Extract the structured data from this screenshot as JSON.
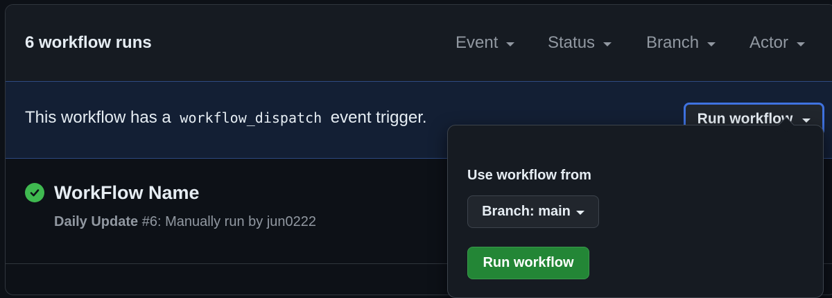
{
  "header": {
    "title": "6 workflow runs",
    "filters": [
      "Event",
      "Status",
      "Branch",
      "Actor"
    ]
  },
  "banner": {
    "text_before": "This workflow has a",
    "code": "workflow_dispatch",
    "text_after": "event trigger.",
    "run_button_label": "Run workflow"
  },
  "run": {
    "title": "WorkFlow Name",
    "workflow_name": "Daily Update",
    "run_number": "#6",
    "description": ": Manually run by jun0222",
    "status_icon": "check-circle-icon"
  },
  "dropdown": {
    "label": "Use workflow from",
    "branch_button_label": "Branch: main",
    "run_button_label": "Run workflow"
  },
  "colors": {
    "accent_blue": "#3f72e0",
    "success_green": "#3fb950",
    "button_green": "#238636"
  }
}
